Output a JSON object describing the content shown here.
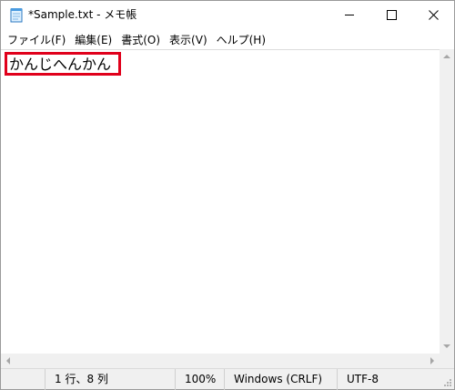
{
  "window": {
    "title": "*Sample.txt - メモ帳"
  },
  "menu": {
    "items": [
      "ファイル(F)",
      "編集(E)",
      "書式(O)",
      "表示(V)",
      "ヘルプ(H)"
    ]
  },
  "editor": {
    "content": "かんじへんかん"
  },
  "status": {
    "position": "1 行、8 列",
    "zoom": "100%",
    "line_ending": "Windows (CRLF)",
    "encoding": "UTF-8"
  },
  "colors": {
    "highlight": "#e0001b",
    "chrome": "#f0f0f0"
  }
}
